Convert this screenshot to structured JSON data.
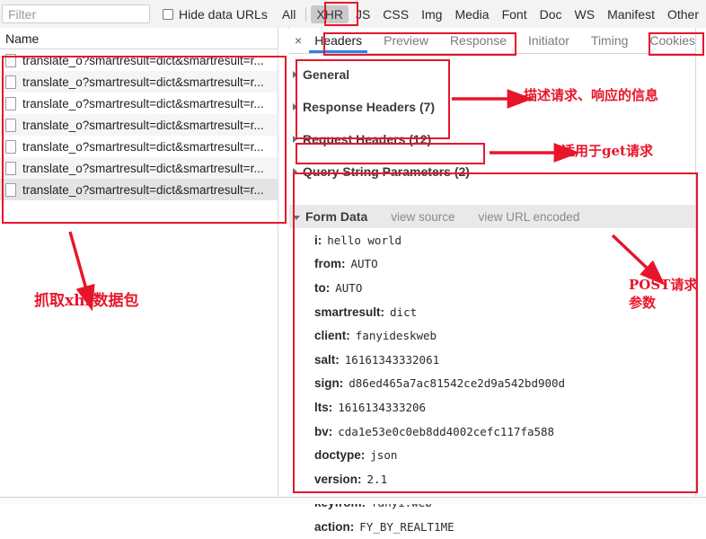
{
  "toolbar": {
    "filter_placeholder": "Filter",
    "filter_value": "",
    "hide_data_urls_label": "Hide data URLs",
    "hide_data_urls_checked": false,
    "types": [
      {
        "label": "All",
        "selected": false
      },
      {
        "label": "XHR",
        "selected": true
      },
      {
        "label": "JS",
        "selected": false
      },
      {
        "label": "CSS",
        "selected": false
      },
      {
        "label": "Img",
        "selected": false
      },
      {
        "label": "Media",
        "selected": false
      },
      {
        "label": "Font",
        "selected": false
      },
      {
        "label": "Doc",
        "selected": false
      },
      {
        "label": "WS",
        "selected": false
      },
      {
        "label": "Manifest",
        "selected": false
      },
      {
        "label": "Other",
        "selected": false
      }
    ]
  },
  "request_list": {
    "column_header": "Name",
    "rows": [
      {
        "name": "translate_o?smartresult=dict&smartresult=r...",
        "selected": false
      },
      {
        "name": "translate_o?smartresult=dict&smartresult=r...",
        "selected": false
      },
      {
        "name": "translate_o?smartresult=dict&smartresult=r...",
        "selected": false
      },
      {
        "name": "translate_o?smartresult=dict&smartresult=r...",
        "selected": false
      },
      {
        "name": "translate_o?smartresult=dict&smartresult=r...",
        "selected": false
      },
      {
        "name": "translate_o?smartresult=dict&smartresult=r...",
        "selected": false
      },
      {
        "name": "translate_o?smartresult=dict&smartresult=r...",
        "selected": true
      }
    ]
  },
  "details": {
    "close_label": "×",
    "tabs": [
      {
        "label": "Headers",
        "active": true
      },
      {
        "label": "Preview",
        "active": false
      },
      {
        "label": "Response",
        "active": false
      },
      {
        "label": "Initiator",
        "active": false
      },
      {
        "label": "Timing",
        "active": false
      },
      {
        "label": "Cookies",
        "active": false
      }
    ],
    "sections": [
      {
        "label": "General",
        "expanded": false
      },
      {
        "label": "Response Headers (7)",
        "expanded": false
      },
      {
        "label": "Request Headers (12)",
        "expanded": false
      },
      {
        "label": "Query String Parameters (2)",
        "expanded": false
      }
    ],
    "form_data": {
      "title": "Form Data",
      "view_source_label": "view source",
      "view_url_encoded_label": "view URL encoded",
      "expanded": true,
      "entries": [
        {
          "key": "i:",
          "value": "hello world"
        },
        {
          "key": "from:",
          "value": "AUTO"
        },
        {
          "key": "to:",
          "value": "AUTO"
        },
        {
          "key": "smartresult:",
          "value": "dict"
        },
        {
          "key": "client:",
          "value": "fanyideskweb"
        },
        {
          "key": "salt:",
          "value": "16161343332061"
        },
        {
          "key": "sign:",
          "value": "d86ed465a7ac81542ce2d9a542bd900d"
        },
        {
          "key": "lts:",
          "value": "1616134333206"
        },
        {
          "key": "bv:",
          "value": "cda1e53e0c0eb8dd4002cefc117fa588"
        },
        {
          "key": "doctype:",
          "value": "json"
        },
        {
          "key": "version:",
          "value": "2.1"
        },
        {
          "key": "keyfrom:",
          "value": "fanyi.web"
        },
        {
          "key": "action:",
          "value": "FY_BY_REALT1ME"
        }
      ]
    }
  },
  "annotations": {
    "color": "#e8152a",
    "notes": [
      {
        "id": "capture-xhr",
        "text": "抓取xhr数据包"
      },
      {
        "id": "describe-req-resp",
        "text": "描述请求、响应的信息"
      },
      {
        "id": "for-get-request",
        "text": "适用于get请求"
      },
      {
        "id": "post-params-line1",
        "text": "POST请求"
      },
      {
        "id": "post-params-line2",
        "text": "参数"
      }
    ]
  }
}
